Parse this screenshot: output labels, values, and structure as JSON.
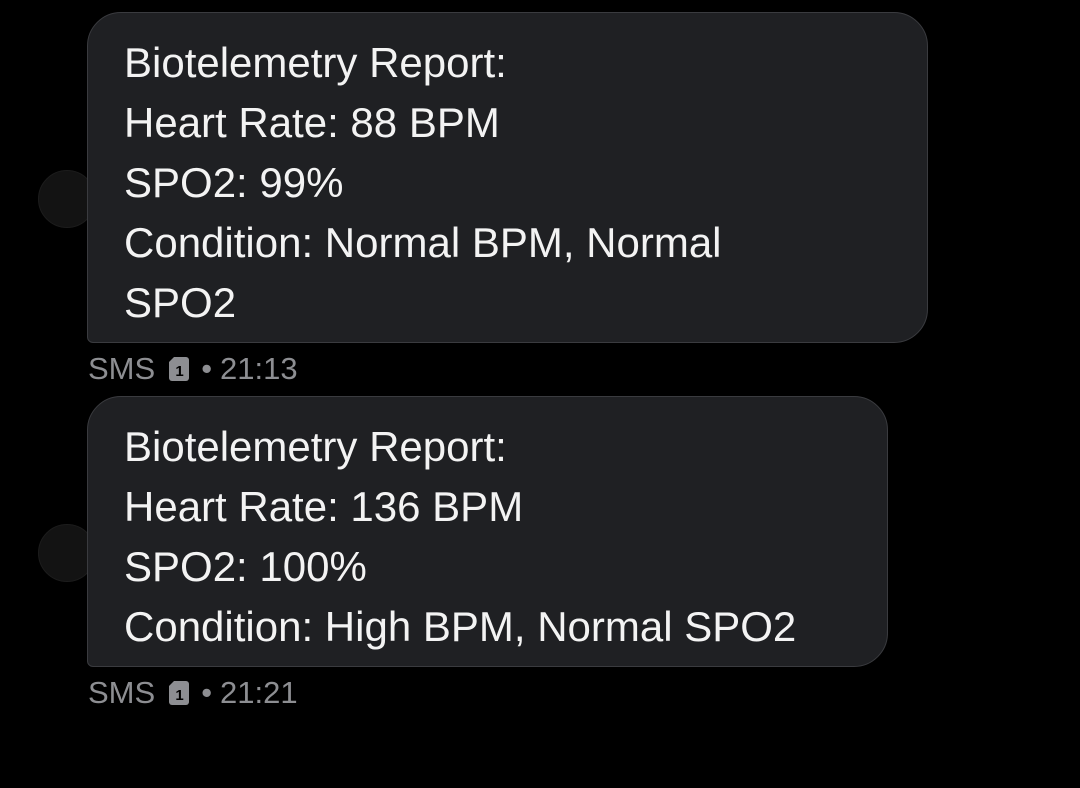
{
  "messages": [
    {
      "lines": [
        "Biotelemetry Report:",
        "Heart Rate: 88 BPM",
        "SPO2: 99%",
        "Condition: Normal BPM, Normal",
        "SPO2"
      ],
      "channel": "SMS",
      "sim_slot": "1",
      "separator": "•",
      "time": "21:13"
    },
    {
      "lines": [
        "Biotelemetry Report:",
        "Heart Rate: 136 BPM",
        "SPO2: 100%",
        "Condition: High BPM, Normal SPO2"
      ],
      "channel": "SMS",
      "sim_slot": "1",
      "separator": "•",
      "time": "21:21"
    }
  ],
  "colors": {
    "background": "#000000",
    "bubble": "#1f2023",
    "bubble_border": "#3a3b3f",
    "text": "#f3f3f3",
    "meta_text": "#8d8e92"
  },
  "icons": {
    "sim": "sim-card-icon",
    "avatar": "contact-avatar"
  }
}
